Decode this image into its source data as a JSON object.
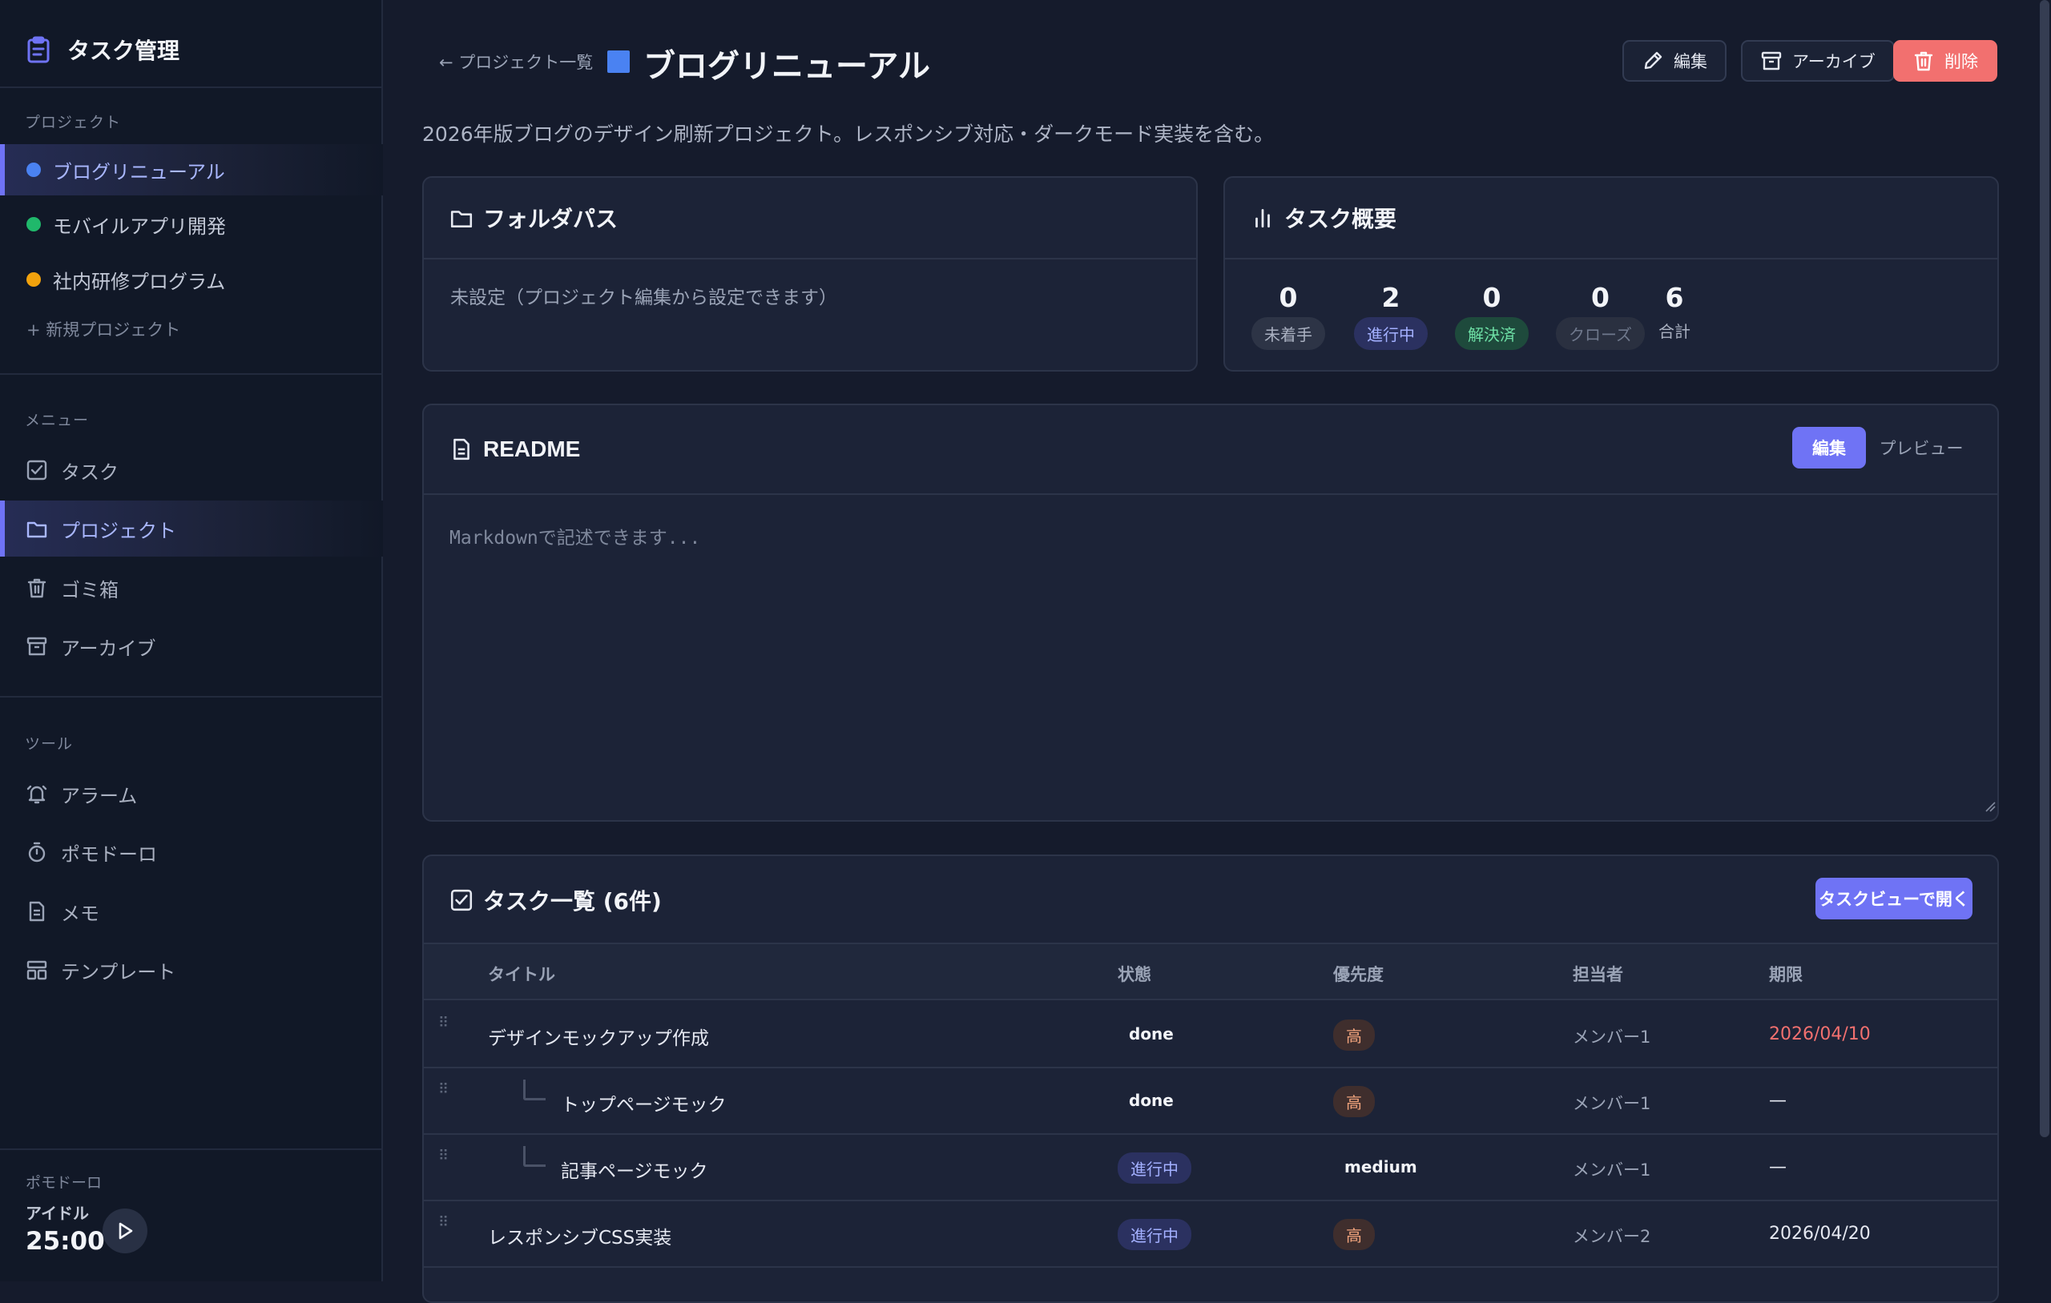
{
  "app": {
    "title": "タスク管理"
  },
  "sidebar": {
    "projects_label": "プロジェクト",
    "projects": [
      {
        "label": "ブログリニューアル",
        "color": "#4a82f2",
        "active": true
      },
      {
        "label": "モバイルアプリ開発",
        "color": "#20b86b",
        "active": false
      },
      {
        "label": "社内研修プログラム",
        "color": "#f2a20d",
        "active": false
      }
    ],
    "new_project": "+ 新規プロジェクト",
    "menu_label": "メニュー",
    "menu": [
      {
        "label": "タスク",
        "icon": "checkbox-icon"
      },
      {
        "label": "プロジェクト",
        "icon": "folder-icon",
        "active": true
      },
      {
        "label": "ゴミ箱",
        "icon": "trash-icon"
      },
      {
        "label": "アーカイブ",
        "icon": "archive-icon"
      }
    ],
    "tools_label": "ツール",
    "tools": [
      {
        "label": "アラーム",
        "icon": "bell-icon"
      },
      {
        "label": "ポモドーロ",
        "icon": "timer-icon"
      },
      {
        "label": "メモ",
        "icon": "note-icon"
      },
      {
        "label": "テンプレート",
        "icon": "template-icon"
      }
    ],
    "pomodoro": {
      "label": "ポモドーロ",
      "state": "アイドル",
      "time": "25:00"
    }
  },
  "header": {
    "back": "← プロジェクト一覧",
    "title": "ブログリニューアル",
    "title_color": "#4a82f2",
    "edit": "編集",
    "archive": "アーカイブ",
    "delete": "削除"
  },
  "description": "2026年版ブログのデザイン刷新プロジェクト。レスポンシブ対応・ダークモード実装を含む。",
  "folder": {
    "title": "フォルダパス",
    "value": "未設定（プロジェクト編集から設定できます）"
  },
  "summary": {
    "title": "タスク概要",
    "stats": [
      {
        "count": "0",
        "label": "未着手"
      },
      {
        "count": "2",
        "label": "進行中"
      },
      {
        "count": "0",
        "label": "解決済"
      },
      {
        "count": "0",
        "label": "クローズ"
      },
      {
        "count": "6",
        "label": "合計"
      }
    ]
  },
  "readme": {
    "title": "README",
    "edit_tab": "編集",
    "preview_tab": "プレビュー",
    "placeholder": "Markdownで記述できます..."
  },
  "tasks": {
    "title": "タスク一覧 (6件)",
    "open_view": "タスクビューで開く",
    "columns": [
      "タイトル",
      "状態",
      "優先度",
      "担当者",
      "期限"
    ],
    "rows": [
      {
        "title": "デザインモックアップ作成",
        "status": "done",
        "priority": "高",
        "assignee": "メンバー1",
        "due": "2026/04/10",
        "level": 0
      },
      {
        "title": "トップページモック",
        "status": "done",
        "priority": "高",
        "assignee": "メンバー1",
        "due": "—",
        "level": 1
      },
      {
        "title": "記事ページモック",
        "status": "進行中",
        "priority": "medium",
        "assignee": "メンバー1",
        "due": "—",
        "level": 1
      },
      {
        "title": "レスポンシブCSS実装",
        "status": "進行中",
        "priority": "高",
        "assignee": "メンバー2",
        "due": "2026/04/20",
        "level": 0
      }
    ]
  },
  "colors": {
    "accent": "#6f73f5",
    "danger": "#f2706f",
    "overdue": "#f2706f"
  }
}
